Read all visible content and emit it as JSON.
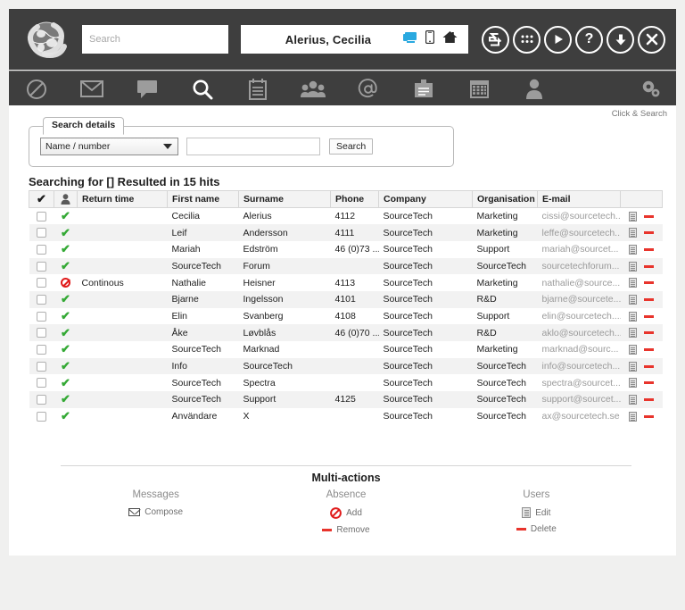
{
  "header": {
    "logo_icon": "globe-logo",
    "search": {
      "placeholder": "Search",
      "value": ""
    },
    "user": {
      "name": "Alerius, Cecilia"
    },
    "user_icons": [
      {
        "name": "desktop-status-icon",
        "glyph": "desktop"
      },
      {
        "name": "mobile-status-icon",
        "glyph": "mobile"
      },
      {
        "name": "home-status-icon",
        "glyph": "home"
      }
    ],
    "round_icons": [
      {
        "name": "transfer-icon",
        "glyph": "S"
      },
      {
        "name": "grid-menu-icon",
        "glyph": "dots"
      },
      {
        "name": "play-icon",
        "glyph": "play"
      },
      {
        "name": "help-icon",
        "glyph": "?"
      },
      {
        "name": "download-icon",
        "glyph": "down-arrow"
      },
      {
        "name": "close-icon",
        "glyph": "x"
      }
    ]
  },
  "toolbar": {
    "items": [
      {
        "name": "absence-icon",
        "glyph": "block"
      },
      {
        "name": "mail-icon",
        "glyph": "envelope"
      },
      {
        "name": "message-icon",
        "glyph": "speech-bubble"
      },
      {
        "name": "search-icon",
        "glyph": "magnifier"
      },
      {
        "name": "notes-icon",
        "glyph": "notepad"
      },
      {
        "name": "groups-icon",
        "glyph": "people"
      },
      {
        "name": "email-at-icon",
        "glyph": "at"
      },
      {
        "name": "contacts-icon",
        "glyph": "card"
      },
      {
        "name": "calendar-icon",
        "glyph": "calendar"
      },
      {
        "name": "user-icon",
        "glyph": "person"
      }
    ],
    "settings": {
      "name": "settings-gear-icon",
      "glyph": "gears"
    }
  },
  "content": {
    "click_search_hint": "Click & Search",
    "search_details": {
      "legend": "Search details",
      "select_value": "Name / number",
      "select_options": [
        "Name / number"
      ],
      "input_value": "",
      "input_placeholder": "",
      "search_button": "Search"
    },
    "results_title": "Searching for [] Resulted in 15 hits",
    "table": {
      "columns": [
        "",
        "",
        "Return time",
        "First name",
        "Surname",
        "Phone",
        "Company",
        "Organisation",
        "E-mail",
        ""
      ],
      "select_all_icon": "check-all-icon",
      "person_column_icon": "person-column-icon",
      "rows": [
        {
          "status": "available",
          "return_time": "",
          "first_name": "Cecilia",
          "surname": "Alerius",
          "phone": "4112",
          "company": "SourceTech",
          "organisation": "Marketing",
          "email": "cissi@sourcetech..."
        },
        {
          "status": "available",
          "return_time": "",
          "first_name": "Leif",
          "surname": "Andersson",
          "phone": "4111",
          "company": "SourceTech",
          "organisation": "Marketing",
          "email": "leffe@sourcetech..."
        },
        {
          "status": "available",
          "return_time": "",
          "first_name": "Mariah",
          "surname": "Edström",
          "phone": "46 (0)73 ...",
          "company": "SourceTech",
          "organisation": "Support",
          "email": "mariah@sourcet..."
        },
        {
          "status": "available",
          "return_time": "",
          "first_name": "SourceTech",
          "surname": "Forum",
          "phone": "",
          "company": "SourceTech",
          "organisation": "SourceTech",
          "email": "sourcetechforum..."
        },
        {
          "status": "absent",
          "return_time": "Continous",
          "first_name": "Nathalie",
          "surname": "Heisner",
          "phone": "4113",
          "company": "SourceTech",
          "organisation": "Marketing",
          "email": "nathalie@source..."
        },
        {
          "status": "available",
          "return_time": "",
          "first_name": "Bjarne",
          "surname": "Ingelsson",
          "phone": "4101",
          "company": "SourceTech",
          "organisation": "R&D",
          "email": "bjarne@sourcete..."
        },
        {
          "status": "available",
          "return_time": "",
          "first_name": "Elin",
          "surname": "Svanberg",
          "phone": "4108",
          "company": "SourceTech",
          "organisation": "Support",
          "email": "elin@sourcetech...."
        },
        {
          "status": "available",
          "return_time": "",
          "first_name": "Åke",
          "surname": "Løvblås",
          "phone": "46 (0)70 ...",
          "company": "SourceTech",
          "organisation": "R&D",
          "email": "aklo@sourcetech..."
        },
        {
          "status": "available",
          "return_time": "",
          "first_name": "SourceTech",
          "surname": "Marknad",
          "phone": "",
          "company": "SourceTech",
          "organisation": "Marketing",
          "email": "marknad@sourc..."
        },
        {
          "status": "available",
          "return_time": "",
          "first_name": "Info",
          "surname": "SourceTech",
          "phone": "",
          "company": "SourceTech",
          "organisation": "SourceTech",
          "email": "info@sourcetech..."
        },
        {
          "status": "available",
          "return_time": "",
          "first_name": "SourceTech",
          "surname": "Spectra",
          "phone": "",
          "company": "SourceTech",
          "organisation": "SourceTech",
          "email": "spectra@sourcet..."
        },
        {
          "status": "available",
          "return_time": "",
          "first_name": "SourceTech",
          "surname": "Support",
          "phone": "4125",
          "company": "SourceTech",
          "organisation": "SourceTech",
          "email": "support@sourcet..."
        },
        {
          "status": "available",
          "return_time": "",
          "first_name": "Användare",
          "surname": "X",
          "phone": "",
          "company": "SourceTech",
          "organisation": "SourceTech",
          "email": "ax@sourcetech.se"
        }
      ]
    },
    "multi_actions": {
      "title": "Multi-actions",
      "columns": [
        {
          "heading": "Messages",
          "actions": [
            {
              "label": "Compose",
              "icon": "envelope-icon"
            }
          ]
        },
        {
          "heading": "Absence",
          "actions": [
            {
              "label": "Add",
              "icon": "block-icon"
            },
            {
              "label": "Remove",
              "icon": "minus-icon"
            }
          ]
        },
        {
          "heading": "Users",
          "actions": [
            {
              "label": "Edit",
              "icon": "edit-document-icon"
            },
            {
              "label": "Delete",
              "icon": "minus-icon"
            }
          ]
        }
      ]
    }
  },
  "colors": {
    "chrome_dark": "#3e3e3e",
    "accent_green": "#34a935",
    "accent_red": "#e8342c",
    "accent_blue": "#2aa9e0",
    "page_bg": "#f0f0ef"
  }
}
